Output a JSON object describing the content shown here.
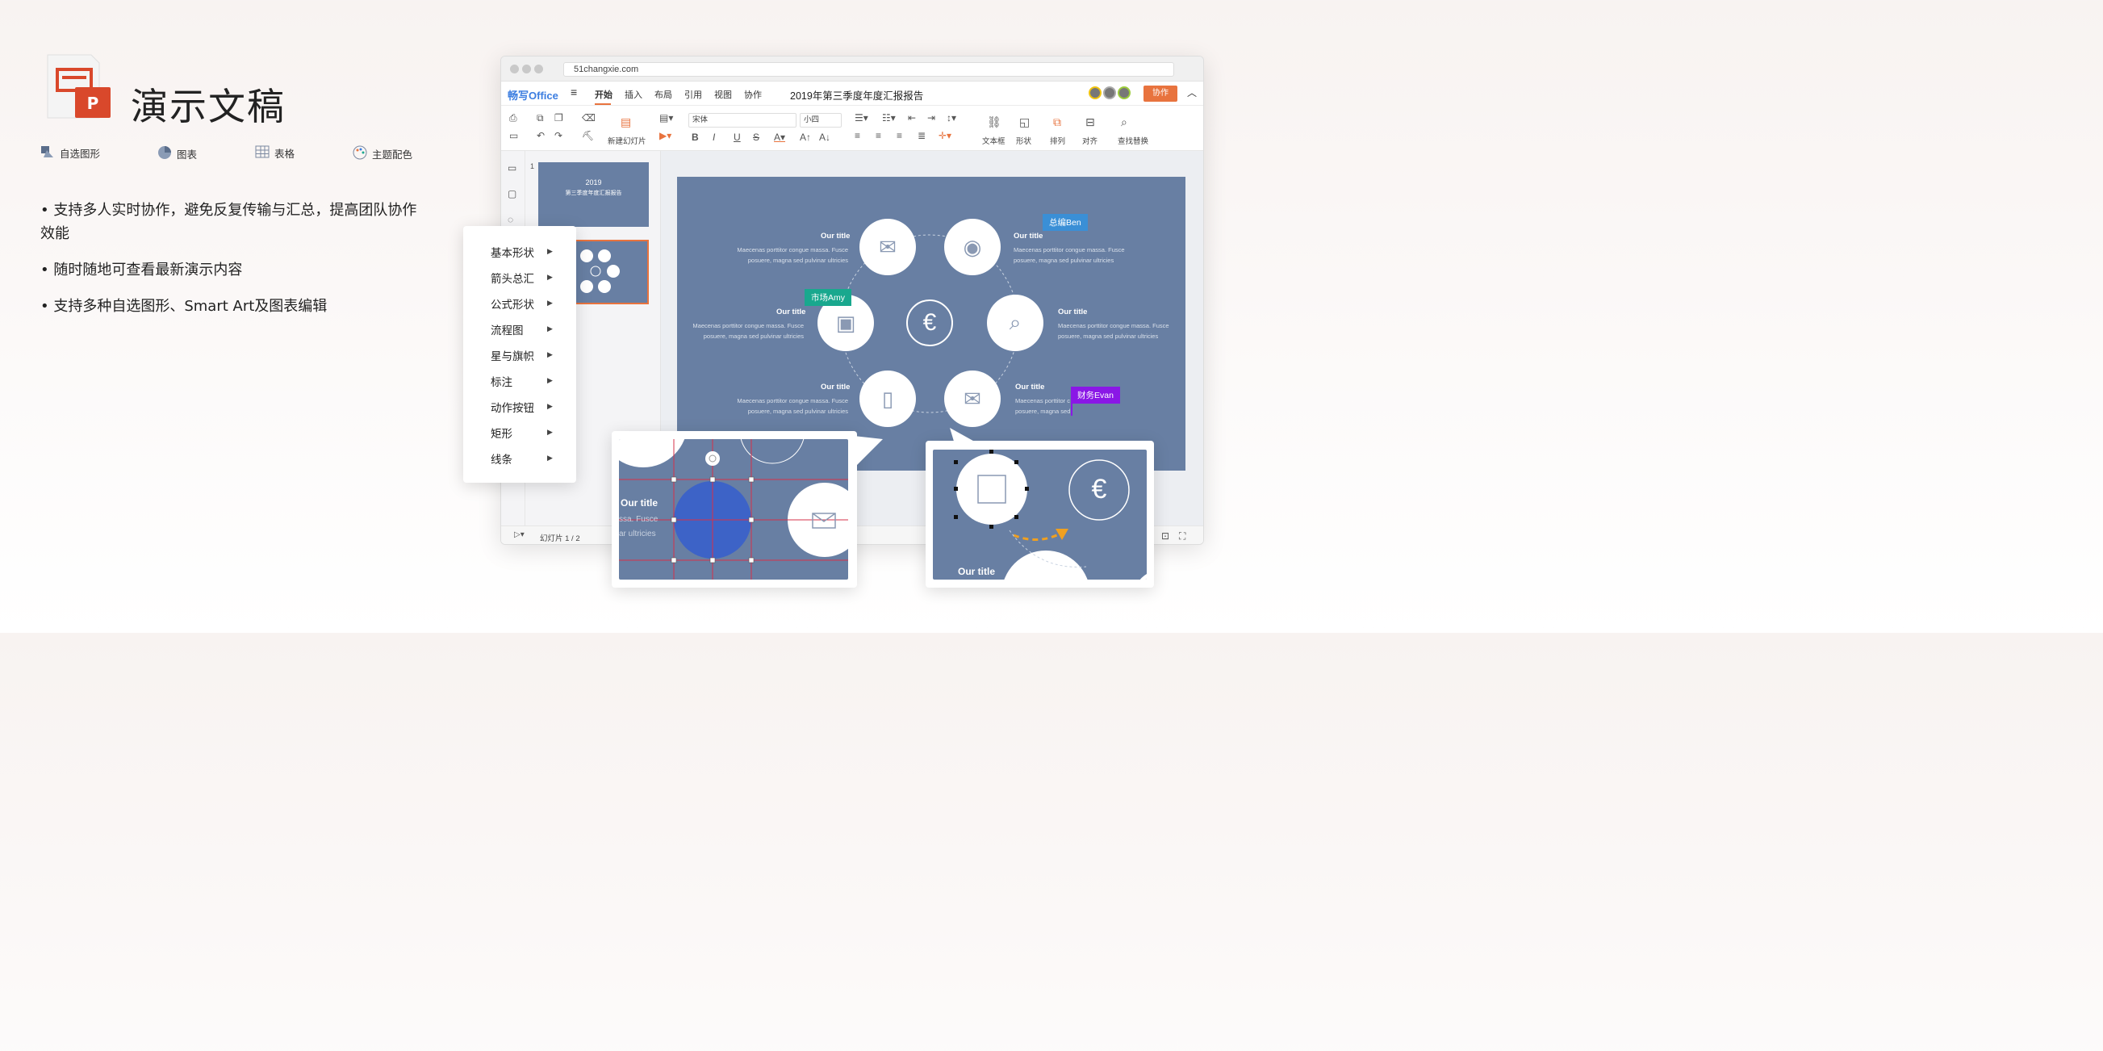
{
  "page": {
    "title": "演示文稿",
    "features": [
      {
        "label": "自选图形",
        "icon": "shapes-icon"
      },
      {
        "label": "图表",
        "icon": "pie-chart-icon"
      },
      {
        "label": "表格",
        "icon": "table-icon"
      },
      {
        "label": "主题配色",
        "icon": "palette-icon"
      }
    ],
    "bullets": [
      "• 支持多人实时协作，避免反复传输与汇总，提高团队协作效能",
      "• 随时随地可查看最新演示内容",
      "• 支持多种自选图形、Smart Art及图表编辑"
    ]
  },
  "browser": {
    "url": "51changxie.com"
  },
  "app": {
    "logo": "畅写Office",
    "menu": [
      "开始",
      "插入",
      "布局",
      "引用",
      "视图",
      "协作"
    ],
    "doc_title": "2019年第三季度年度汇报报告",
    "collab_button": "协作",
    "toolbar": {
      "new_slide": "新建幻灯片",
      "font_name": "宋体",
      "font_size": "小四",
      "textbox": "文本框",
      "shape": "形状",
      "arrange": "排列",
      "align": "对齐",
      "find_replace": "查找替换"
    },
    "thumbnails": {
      "slide1_year": "2019",
      "slide1_title": "第三季度年度汇报报告",
      "slide1_num": "1"
    },
    "status": "幻灯片 1 / 2"
  },
  "slide": {
    "item_title": "Our title",
    "item_text": "Maecenas porttitor congue massa. Fusce posuere, magna sed pulvinar ultricies",
    "center_symbol": "€",
    "tags": [
      {
        "label": "总编Ben",
        "color": "#3a8fd6"
      },
      {
        "label": "市场Amy",
        "color": "#19a88e"
      },
      {
        "label": "财务Evan",
        "color": "#8a17e6"
      }
    ],
    "truncated_text": "Maecenas porttitor c",
    "truncated_text2": "posuere, magna sed"
  },
  "context_menu": [
    "基本形状",
    "箭头总汇",
    "公式形状",
    "流程图",
    "星与旗帜",
    "标注",
    "动作按钮",
    "矩形",
    "线条"
  ],
  "zoom_left": {
    "title": "Our title",
    "text1": "ssa. Fusce",
    "text2": "ar ultricies"
  },
  "zoom_right": {
    "title": "Our title",
    "symbol": "€"
  },
  "colors": {
    "accent": "#e8733e",
    "slide_bg": "#687fa3",
    "brand_blue": "#3b7de0"
  }
}
